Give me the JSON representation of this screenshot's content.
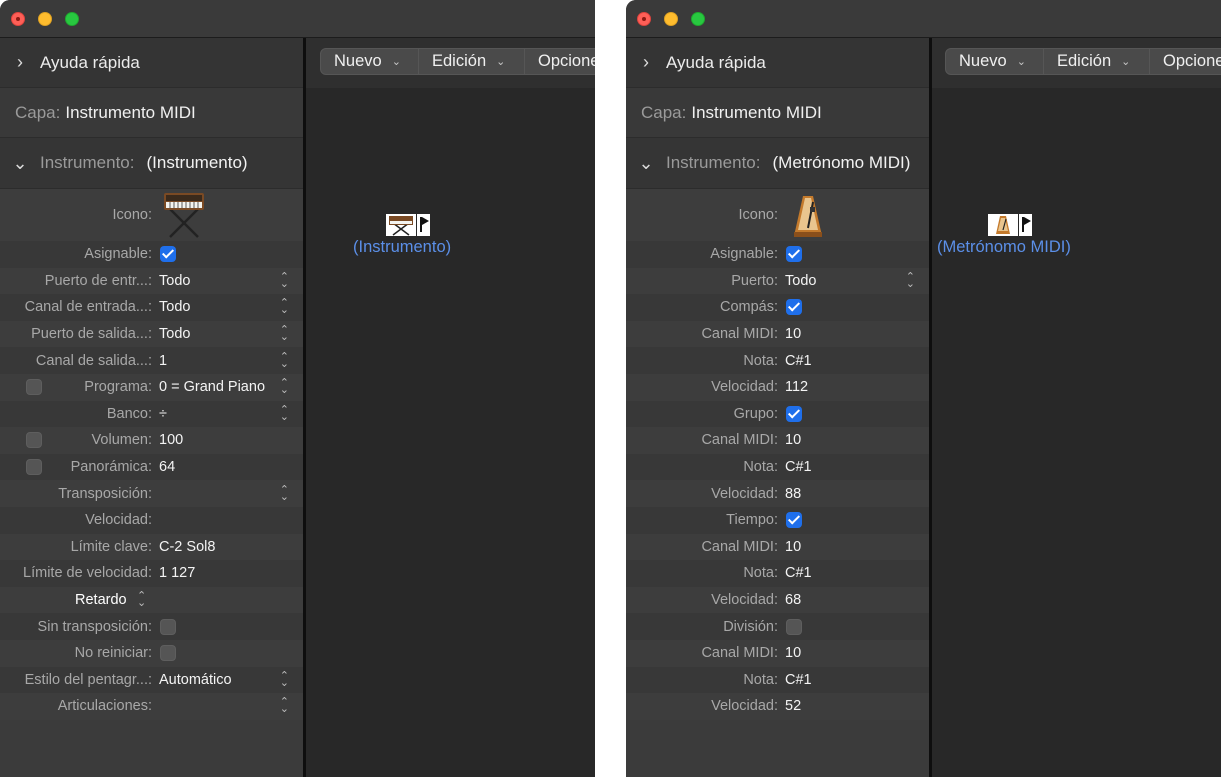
{
  "colors": {
    "accent_check": "#1f6feb",
    "object_label": "#5b8fe8",
    "traffic_red": "#fe5f57",
    "traffic_yellow": "#febc2e",
    "traffic_green": "#28c840"
  },
  "left": {
    "help_title": "Ayuda rápida",
    "layer_key": "Capa:",
    "layer_value": "Instrumento MIDI",
    "instr_key": "Instrumento:",
    "instr_value": "(Instrumento)",
    "icon_label": "Icono:",
    "icon_name": "synthesizer-icon",
    "rows": [
      {
        "label": "Asignable:",
        "check": "on"
      },
      {
        "label": "Puerto de entr...:",
        "value": "Todo",
        "stepper": true
      },
      {
        "label": "Canal de entrada...:",
        "value": "Todo",
        "stepper": true
      },
      {
        "label": "Puerto de salida...:",
        "value": "Todo",
        "stepper": true
      },
      {
        "label": "Canal de salida...:",
        "value": "1",
        "stepper": true
      },
      {
        "label": "Programa:",
        "value": "0 = Grand Piano",
        "stepper": true,
        "leftbox": true
      },
      {
        "label": "Banco:",
        "value": "÷",
        "stepper": true
      },
      {
        "label": "Volumen:",
        "value": "100",
        "leftbox": true
      },
      {
        "label": "Panorámica:",
        "value": "64",
        "leftbox": true
      },
      {
        "label": "Transposición:",
        "stepper": true
      },
      {
        "label": "Velocidad:"
      },
      {
        "label": "Límite clave:",
        "value": "C-2  Sol8"
      },
      {
        "label": "Límite de velocidad:",
        "value": "1   127"
      },
      {
        "retardo": "Retardo"
      },
      {
        "label": "Sin transposición:",
        "check": "off"
      },
      {
        "label": "No reiniciar:",
        "check": "off"
      },
      {
        "label": "Estilo del pentagr...:",
        "value": "Automático",
        "stepper": true
      },
      {
        "label": "Articulaciones:",
        "stepper": true
      }
    ],
    "toolbar": {
      "new": "Nuevo",
      "edit": "Edición",
      "options": "Opciones"
    },
    "object_label": "(Instrumento)"
  },
  "right": {
    "help_title": "Ayuda rápida",
    "layer_key": "Capa:",
    "layer_value": "Instrumento MIDI",
    "instr_key": "Instrumento:",
    "instr_value": "(Metrónomo MIDI)",
    "icon_label": "Icono:",
    "icon_name": "metronome-icon",
    "rows": [
      {
        "label": "Asignable:",
        "check": "on"
      },
      {
        "label": "Puerto:",
        "value": "Todo",
        "stepper": true
      },
      {
        "label": "Compás:",
        "check": "on"
      },
      {
        "label": "Canal MIDI:",
        "value": "10"
      },
      {
        "label": "Nota:",
        "value": "C#1"
      },
      {
        "label": "Velocidad:",
        "value": "112"
      },
      {
        "label": "Grupo:",
        "check": "on"
      },
      {
        "label": "Canal MIDI:",
        "value": "10"
      },
      {
        "label": "Nota:",
        "value": "C#1"
      },
      {
        "label": "Velocidad:",
        "value": "88"
      },
      {
        "label": "Tiempo:",
        "check": "on"
      },
      {
        "label": "Canal MIDI:",
        "value": "10"
      },
      {
        "label": "Nota:",
        "value": "C#1"
      },
      {
        "label": "Velocidad:",
        "value": "68"
      },
      {
        "label": "División:",
        "check": "off"
      },
      {
        "label": "Canal MIDI:",
        "value": "10"
      },
      {
        "label": "Nota:",
        "value": "C#1"
      },
      {
        "label": "Velocidad:",
        "value": "52"
      }
    ],
    "toolbar": {
      "new": "Nuevo",
      "edit": "Edición",
      "options": "Opciones"
    },
    "object_label": "(Metrónomo MIDI)"
  }
}
